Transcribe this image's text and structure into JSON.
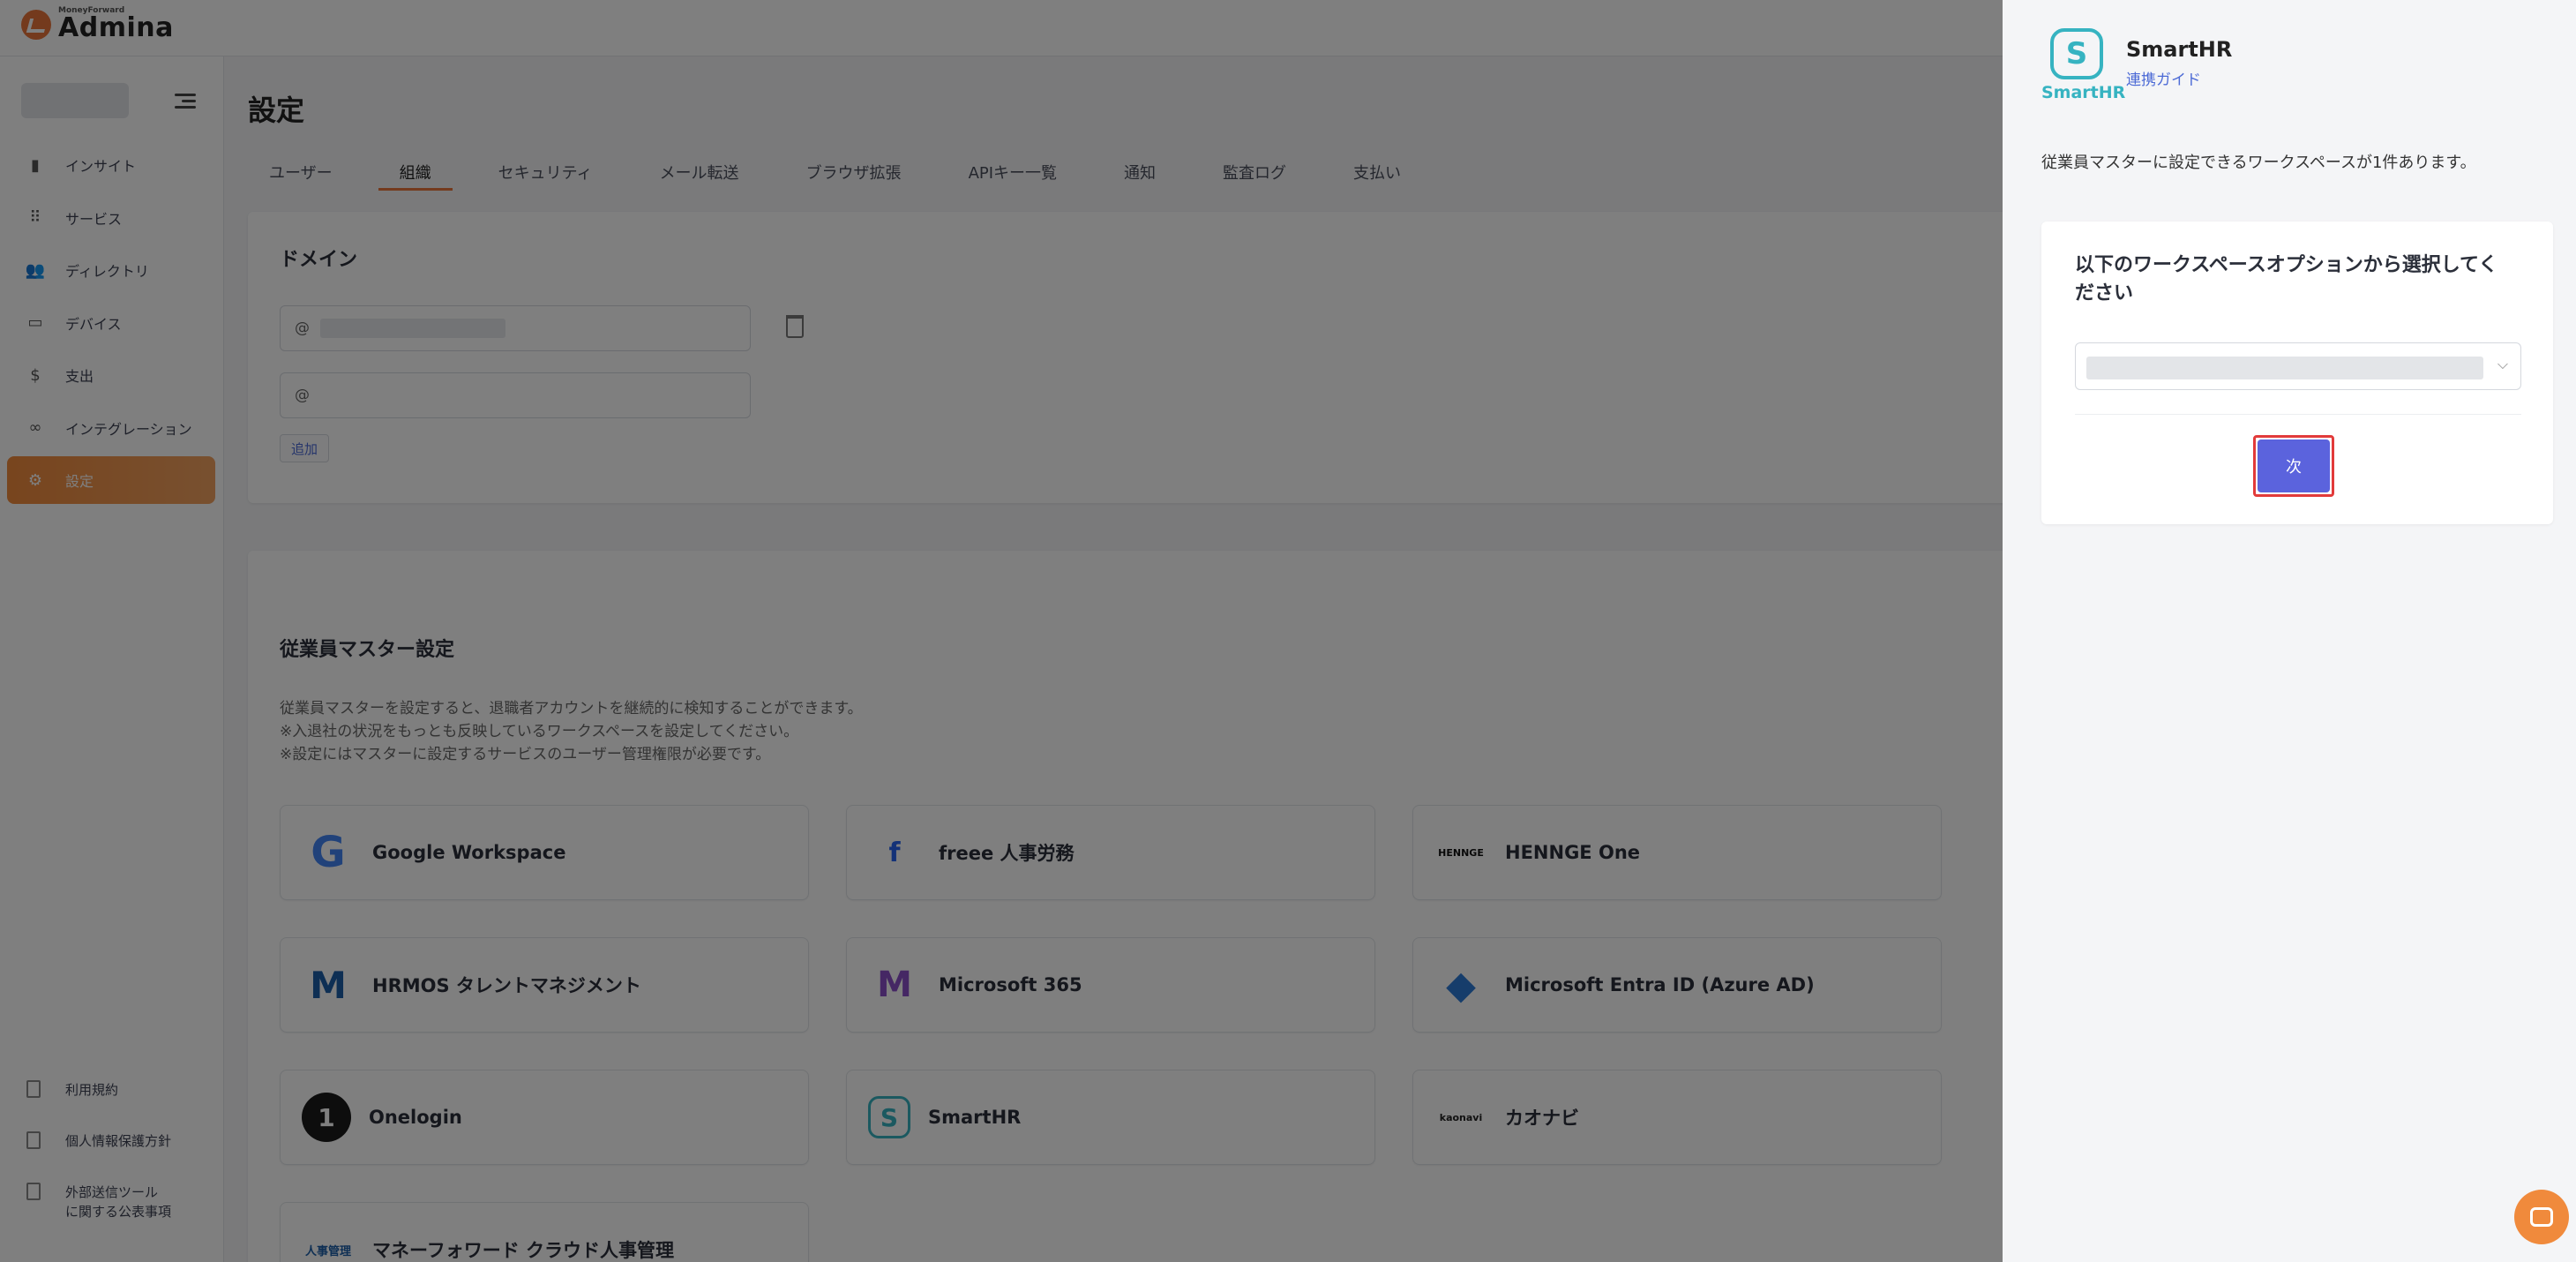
{
  "app": {
    "logo_small": "MoneyForward",
    "logo_big": "Admina"
  },
  "sidebar": {
    "items": [
      {
        "label": "インサイト",
        "icon": "bar-chart-icon"
      },
      {
        "label": "サービス",
        "icon": "grid-icon"
      },
      {
        "label": "ディレクトリ",
        "icon": "users-icon"
      },
      {
        "label": "デバイス",
        "icon": "laptop-icon"
      },
      {
        "label": "支出",
        "icon": "dollar-icon"
      },
      {
        "label": "インテグレーション",
        "icon": "link-icon"
      },
      {
        "label": "設定",
        "icon": "gear-icon",
        "active": true
      }
    ],
    "footer": [
      {
        "label": "利用規約",
        "icon": "document-icon"
      },
      {
        "label": "個人情報保護方針",
        "icon": "document-icon"
      },
      {
        "label": "外部送信ツール\nに関する公表事項",
        "icon": "document-icon"
      }
    ]
  },
  "main": {
    "title": "設定",
    "tabs": [
      "ユーザー",
      "組織",
      "セキュリティ",
      "メール転送",
      "ブラウザ拡張",
      "APIキー一覧",
      "通知",
      "監査ログ",
      "支払い"
    ],
    "active_tab": "組織",
    "domain": {
      "title": "ドメイン",
      "input1_prefix": "@",
      "input2_prefix": "@",
      "add_label": "追加"
    },
    "employee_master": {
      "title": "従業員マスター設定",
      "desc1": "従業員マスターを設定すると、退職者アカウントを継続的に検知することができます。",
      "desc2": "※入退社の状況をもっとも反映しているワークスペースを設定してください。",
      "desc3": "※設定にはマスターに設定するサービスのユーザー管理権限が必要です。",
      "services": [
        {
          "name": "Google Workspace",
          "logo": "G"
        },
        {
          "name": "freee 人事労務",
          "logo": "f"
        },
        {
          "name": "HENNGE One",
          "logo": "HENNGE"
        },
        {
          "name": "HRMOS タレントマネジメント",
          "logo": "M"
        },
        {
          "name": "Microsoft 365",
          "logo": "M"
        },
        {
          "name": "Microsoft Entra ID (Azure AD)",
          "logo": "◆"
        },
        {
          "name": "Onelogin",
          "logo": "1"
        },
        {
          "name": "SmartHR",
          "logo": "S"
        },
        {
          "name": "カオナビ",
          "logo": "kaonavi"
        },
        {
          "name": "マネーフォワード クラウド人事管理",
          "logo": "人事管理"
        }
      ]
    }
  },
  "drawer": {
    "service_name": "SmartHR",
    "logo_word": "SmartHR",
    "logo_glyph": "S",
    "guide_link": "連携ガイド",
    "info": "従業員マスターに設定できるワークスペースが1件あります。",
    "panel_title": "以下のワークスペースオプションから選択してください",
    "select_chevron": "⌵",
    "next_label": "次"
  },
  "colors": {
    "accent_orange": "#f08a3c",
    "brand_teal": "#36b3c1",
    "primary_button": "#5b63dd",
    "highlight_red": "#e23b3b",
    "link_blue": "#4d6bd6"
  }
}
